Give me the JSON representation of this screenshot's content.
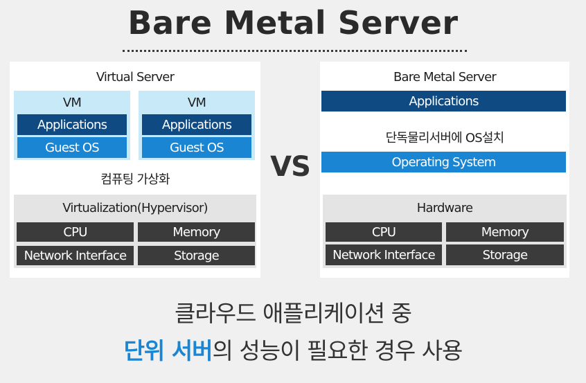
{
  "title": "Bare Metal Server",
  "vs": "VS",
  "left": {
    "heading": "Virtual Server",
    "vm_left": {
      "label": "VM",
      "applications": "Applications",
      "guest_os": "Guest OS"
    },
    "vm_right": {
      "label": "VM",
      "applications": "Applications",
      "guest_os": "Guest OS"
    },
    "virtualization_caption": "컴퓨팅 가상화",
    "hypervisor": "Virtualization(Hypervisor)",
    "cpu": "CPU",
    "memory": "Memory",
    "network": "Network Interface",
    "storage": "Storage"
  },
  "right": {
    "heading": "Bare Metal Server",
    "applications": "Applications",
    "os_caption": "단독물리서버에 OS설치",
    "os": "Operating System",
    "hardware": "Hardware",
    "cpu": "CPU",
    "memory": "Memory",
    "network": "Network Interface",
    "storage": "Storage"
  },
  "bottom": {
    "line1": "클라우드 애플리케이션 중",
    "line2_highlight": "단위 서버",
    "line2_rest": "의 성능이 필요한 경우 사용"
  },
  "colors": {
    "navy": "#0f4a83",
    "blue": "#1a86d3",
    "light_blue": "#c8e9f7",
    "dark_gray": "#3b3b3b",
    "light_gray": "#e4e4e4"
  }
}
